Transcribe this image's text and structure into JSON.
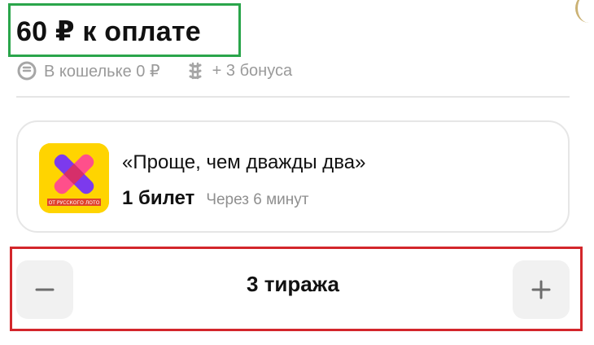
{
  "payment": {
    "title": "60 ₽ к оплате"
  },
  "wallet": {
    "icon": "wallet-icon",
    "text": "В кошельке 0 ₽"
  },
  "bonus": {
    "icon": "bonus-icon",
    "text": "+ 3 бонуса"
  },
  "lottery": {
    "name": "«Проще, чем дважды два»",
    "tickets": "1 билет",
    "time": "Через 6 минут",
    "logo_caption": "ОТ РУССКОГО ЛОТО"
  },
  "draws": {
    "value": "3 тиража",
    "minus_icon": "minus-icon",
    "plus_icon": "plus-icon"
  },
  "colors": {
    "highlight_green": "#2aa54b",
    "highlight_red": "#d3262b",
    "logo_yellow": "#ffd400"
  }
}
